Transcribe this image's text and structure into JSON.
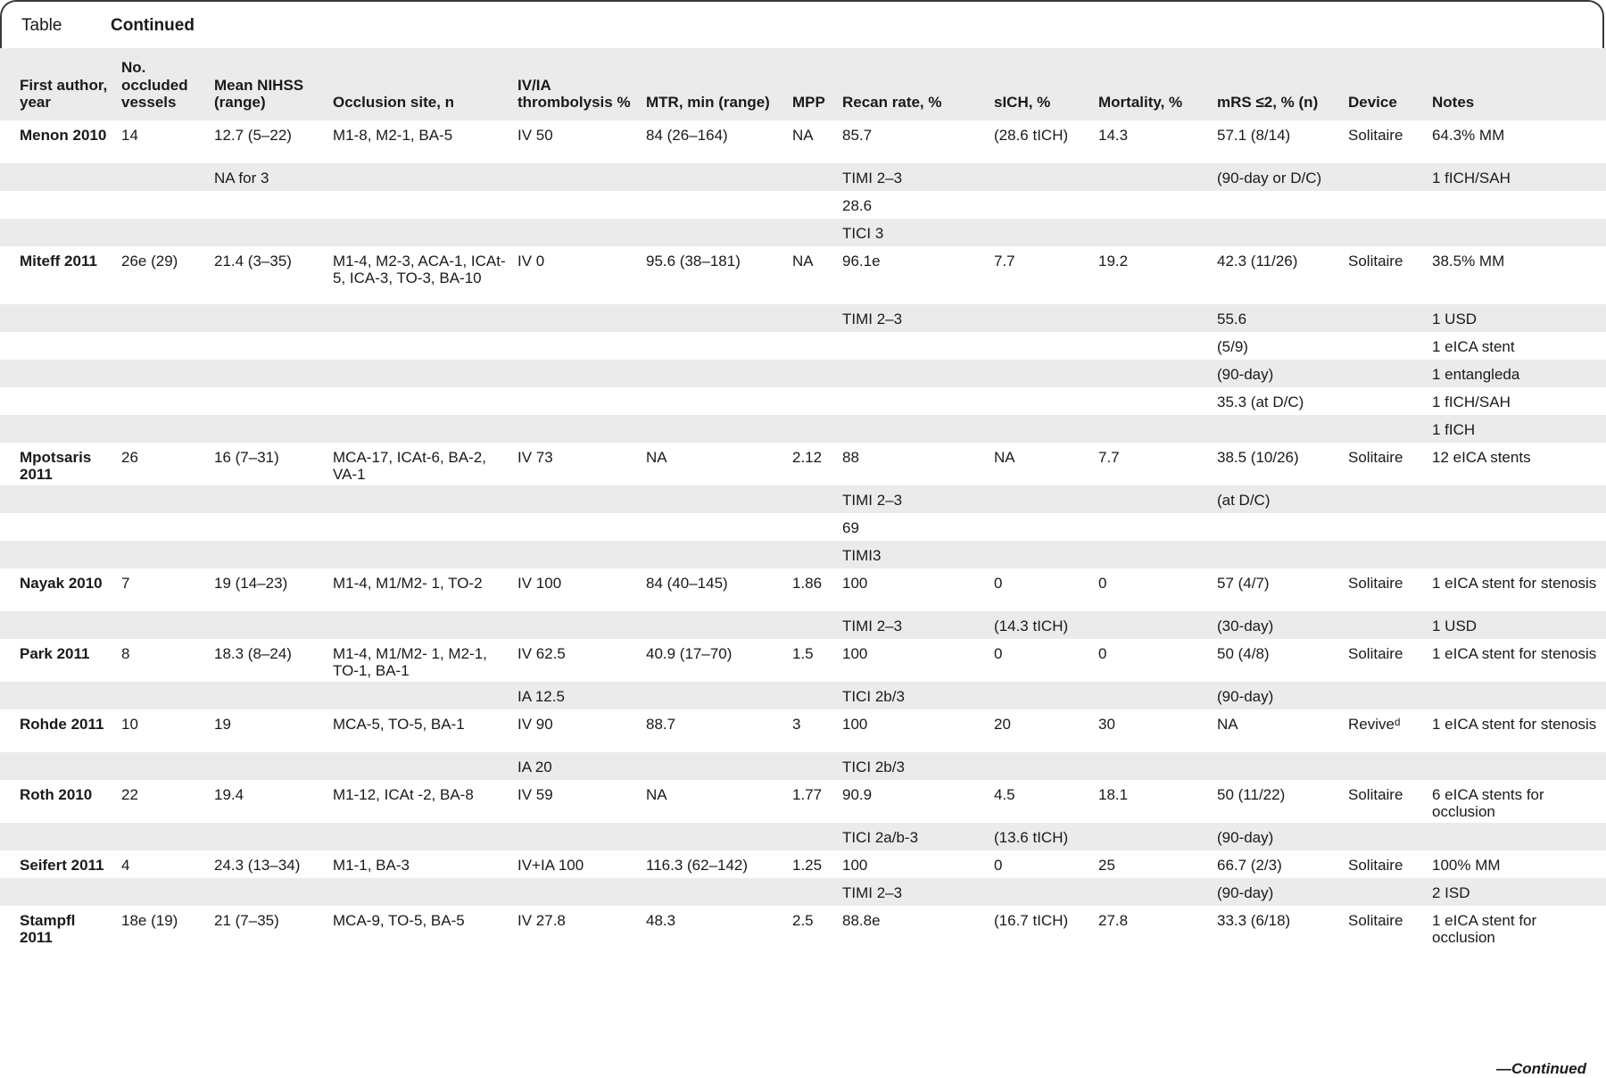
{
  "header": {
    "tag": "Table",
    "continued": "Continued"
  },
  "columns": [
    "First author, year",
    "No. occluded vessels",
    "Mean NIHSS (range)",
    "Occlusion site, n",
    "IV/IA thrombolysis %",
    "MTR, min (range)",
    "MPP",
    "Recan rate, %",
    "sICH, %",
    "Mortality, %",
    "mRS ≤2, % (n)",
    "Device",
    "Notes"
  ],
  "rows": [
    {
      "h": 2,
      "cells": [
        "Menon 2010",
        "14",
        "12.7 (5–22)",
        "M1-8, M2-1, BA-5",
        "IV 50",
        "84 (26–164)",
        "NA",
        "85.7",
        "(28.6 tICH)",
        "14.3",
        "57.1 (8/14)",
        "Solitaire",
        "64.3% MM"
      ]
    },
    {
      "h": 1,
      "cells": [
        "",
        "",
        "NA for 3",
        "",
        "",
        "",
        "",
        "TIMI 2–3",
        "",
        "",
        "(90-day or D/C)",
        "",
        "1 fICH/SAH"
      ]
    },
    {
      "h": 1,
      "cells": [
        "",
        "",
        "",
        "",
        "",
        "",
        "",
        "28.6",
        "",
        "",
        "",
        "",
        ""
      ]
    },
    {
      "h": 1,
      "cells": [
        "",
        "",
        "",
        "",
        "",
        "",
        "",
        "TICI 3",
        "",
        "",
        "",
        "",
        ""
      ]
    },
    {
      "h": 3,
      "cells": [
        "Miteff 2011",
        "26e (29)",
        "21.4 (3–35)",
        "M1-4, M2-3, ACA-1, ICAt-5, ICA-3, TO-3, BA-10",
        "IV 0",
        "95.6 (38–181)",
        "NA",
        "96.1e",
        "7.7",
        "19.2",
        "42.3 (11/26)",
        "Solitaire",
        "38.5% MM"
      ]
    },
    {
      "h": 1,
      "cells": [
        "",
        "",
        "",
        "",
        "",
        "",
        "",
        "TIMI 2–3",
        "",
        "",
        "55.6",
        "",
        "1 USD"
      ]
    },
    {
      "h": 1,
      "cells": [
        "",
        "",
        "",
        "",
        "",
        "",
        "",
        "",
        "",
        "",
        "(5/9)",
        "",
        "1 eICA stent"
      ]
    },
    {
      "h": 1,
      "cells": [
        "",
        "",
        "",
        "",
        "",
        "",
        "",
        "",
        "",
        "",
        "(90-day)",
        "",
        "1 entangleda"
      ]
    },
    {
      "h": 1,
      "cells": [
        "",
        "",
        "",
        "",
        "",
        "",
        "",
        "",
        "",
        "",
        "35.3 (at D/C)",
        "",
        "1 fICH/SAH"
      ]
    },
    {
      "h": 1,
      "cells": [
        "",
        "",
        "",
        "",
        "",
        "",
        "",
        "",
        "",
        "",
        "",
        "",
        "1 fICH"
      ]
    },
    {
      "h": 2,
      "cells": [
        "Mpotsaris 2011",
        "26",
        "16 (7–31)",
        "MCA-17, ICAt-6, BA-2, VA-1",
        "IV 73",
        "NA",
        "2.12",
        "88",
        "NA",
        "7.7",
        "38.5 (10/26)",
        "Solitaire",
        "12 eICA stents"
      ]
    },
    {
      "h": 1,
      "cells": [
        "",
        "",
        "",
        "",
        "",
        "",
        "",
        "TIMI 2–3",
        "",
        "",
        "(at D/C)",
        "",
        ""
      ]
    },
    {
      "h": 1,
      "cells": [
        "",
        "",
        "",
        "",
        "",
        "",
        "",
        "69",
        "",
        "",
        "",
        "",
        ""
      ]
    },
    {
      "h": 1,
      "cells": [
        "",
        "",
        "",
        "",
        "",
        "",
        "",
        "TIMI3",
        "",
        "",
        "",
        "",
        ""
      ]
    },
    {
      "h": 2,
      "cells": [
        "Nayak 2010",
        "7",
        "19 (14–23)",
        "M1-4, M1/M2- 1, TO-2",
        "IV 100",
        "84 (40–145)",
        "1.86",
        "100",
        "0",
        "0",
        "57 (4/7)",
        "Solitaire",
        "1 eICA stent for stenosis"
      ]
    },
    {
      "h": 1,
      "cells": [
        "",
        "",
        "",
        "",
        "",
        "",
        "",
        "TIMI 2–3",
        "(14.3 tICH)",
        "",
        "(30-day)",
        "",
        "1 USD"
      ]
    },
    {
      "h": 2,
      "cells": [
        "Park 2011",
        "8",
        "18.3 (8–24)",
        "M1-4, M1/M2- 1, M2-1, TO-1, BA-1",
        "IV 62.5",
        "40.9 (17–70)",
        "1.5",
        "100",
        "0",
        "0",
        "50 (4/8)",
        "Solitaire",
        "1 eICA stent for stenosis"
      ]
    },
    {
      "h": 1,
      "cells": [
        "",
        "",
        "",
        "",
        "IA 12.5",
        "",
        "",
        "TICI 2b/3",
        "",
        "",
        "(90-day)",
        "",
        ""
      ]
    },
    {
      "h": 2,
      "cells": [
        "Rohde 2011",
        "10",
        "19",
        "MCA-5, TO-5, BA-1",
        "IV 90",
        "88.7",
        "3",
        "100",
        "20",
        "30",
        "NA",
        "Reviveᵈ",
        "1 eICA stent for stenosis"
      ]
    },
    {
      "h": 1,
      "cells": [
        "",
        "",
        "",
        "",
        "IA 20",
        "",
        "",
        "TICI 2b/3",
        "",
        "",
        "",
        "",
        ""
      ]
    },
    {
      "h": 2,
      "cells": [
        "Roth 2010",
        "22",
        "19.4",
        "M1-12, ICAt -2, BA-8",
        "IV 59",
        "NA",
        "1.77",
        "90.9",
        "4.5",
        "18.1",
        "50 (11/22)",
        "Solitaire",
        "6 eICA stents for occlusion"
      ]
    },
    {
      "h": 1,
      "cells": [
        "",
        "",
        "",
        "",
        "",
        "",
        "",
        "TICI 2a/b-3",
        "(13.6 tICH)",
        "",
        "(90-day)",
        "",
        ""
      ]
    },
    {
      "h": 1,
      "cells": [
        "Seifert 2011",
        "4",
        "24.3 (13–34)",
        "M1-1, BA-3",
        "IV+IA 100",
        "116.3 (62–142)",
        "1.25",
        "100",
        "0",
        "25",
        "66.7 (2/3)",
        "Solitaire",
        "100% MM"
      ]
    },
    {
      "h": 1,
      "cells": [
        "",
        "",
        "",
        "",
        "",
        "",
        "",
        "TIMI 2–3",
        "",
        "",
        "(90-day)",
        "",
        "2 ISD"
      ]
    },
    {
      "h": 2,
      "cells": [
        "Stampfl 2011",
        "18e (19)",
        "21 (7–35)",
        "MCA-9, TO-5, BA-5",
        "IV 27.8",
        "48.3",
        "2.5",
        "88.8e",
        "(16.7 tICH)",
        "27.8",
        "33.3 (6/18)",
        "Solitaire",
        "1 eICA stent for occlusion"
      ]
    }
  ],
  "footer": "—Continued"
}
